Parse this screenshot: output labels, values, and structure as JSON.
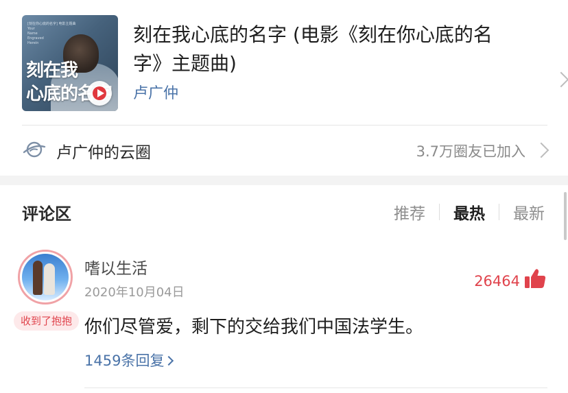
{
  "song": {
    "cover_small_lines": [
      "[刻在你心底的名字] 电影主题曲",
      "Your",
      "Name",
      "Engraved",
      "Herein"
    ],
    "cover_title_line1": "刻在我",
    "cover_title_line2": "心底的名字",
    "title": "刻在我心底的名字 (电影《刻在你心底的名字》主题曲)",
    "artist": "卢广仲"
  },
  "cloud_circle": {
    "label": "卢广仲的云圈",
    "count": "3.7万圈友已加入"
  },
  "comments": {
    "section_title": "评论区",
    "sort_tabs": [
      {
        "label": "推荐",
        "active": false
      },
      {
        "label": "最热",
        "active": true
      },
      {
        "label": "最新",
        "active": false
      }
    ],
    "items": [
      {
        "username": "嗜以生活",
        "date": "2020年10月04日",
        "badge": "收到了抱抱",
        "likes": "26464",
        "text": "你们尽管爱，剩下的交给我们中国法学生。",
        "replies": "1459条回复"
      }
    ]
  },
  "colors": {
    "accent_blue": "#4a73a8",
    "like_red": "#e0434c",
    "badge_bg": "#fde9ea"
  }
}
